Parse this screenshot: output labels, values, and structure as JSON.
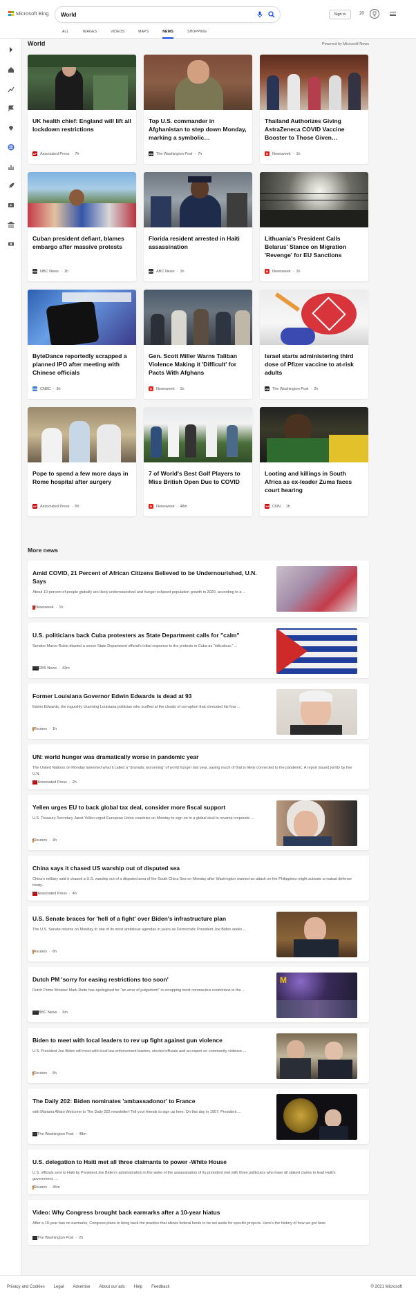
{
  "brand": {
    "name": "Microsoft Bing"
  },
  "search": {
    "value": "World",
    "placeholder": ""
  },
  "header": {
    "signin_label": "Sign in",
    "reward_count": "20"
  },
  "tabs": [
    {
      "label": "ALL"
    },
    {
      "label": "IMAGES"
    },
    {
      "label": "VIDEOS"
    },
    {
      "label": "MAPS"
    },
    {
      "label": "NEWS"
    },
    {
      "label": "SHOPPING"
    }
  ],
  "active_tab": "NEWS",
  "section": {
    "title": "World",
    "powered_by": "Powered by Microsoft News"
  },
  "cards": [
    {
      "title": "UK health chief: England will lift all lockdown restrictions",
      "source": "Associated Press",
      "age": "7h",
      "src_logo": "AP",
      "src_color": "#cc0000"
    },
    {
      "title": "Top U.S. commander in Afghanistan to step down Monday, marking a symbolic…",
      "source": "The Washington Post",
      "age": "7h",
      "src_logo": "wp",
      "src_color": "#222222"
    },
    {
      "title": "Thailand Authorizes Giving AstraZeneca COVID Vaccine Booster to Those Given…",
      "source": "Newsweek",
      "age": "1h",
      "src_logo": "N",
      "src_color": "#e2231a"
    },
    {
      "title": "Cuban president defiant, blames embargo after massive protests",
      "source": "NBC News",
      "age": "1h",
      "src_logo": "nbc",
      "src_color": "#333333"
    },
    {
      "title": "Florida resident arrested in Haiti assassination",
      "source": "ABC News",
      "age": "1h",
      "src_logo": "abc",
      "src_color": "#333333"
    },
    {
      "title": "Lithuania's President Calls Belarus' Stance on Migration 'Revenge' for EU Sanctions",
      "source": "Newsweek",
      "age": "1h",
      "src_logo": "N",
      "src_color": "#e2231a"
    },
    {
      "title": "ByteDance reportedly scrapped a planned IPO after meeting with Chinese officials",
      "source": "CNBC",
      "age": "3h",
      "src_logo": "cnbc",
      "src_color": "#3a7bd5"
    },
    {
      "title": "Gen. Scott Miller Warns Taliban Violence Making it 'Difficult' for Pacts With Afghans",
      "source": "Newsweek",
      "age": "1h",
      "src_logo": "N",
      "src_color": "#e2231a"
    },
    {
      "title": "Israel starts administering third dose of Pfizer vaccine to at-risk adults",
      "source": "The Washington Post",
      "age": "2h",
      "src_logo": "wp",
      "src_color": "#222222"
    },
    {
      "title": "Pope to spend a few more days in Rome hospital after surgery",
      "source": "Associated Press",
      "age": "5h",
      "src_logo": "AP",
      "src_color": "#cc0000"
    },
    {
      "title": "7 of World's Best Golf Players to Miss British Open Due to COVID",
      "source": "Newsweek",
      "age": "48m",
      "src_logo": "N",
      "src_color": "#e2231a"
    },
    {
      "title": "Looting and killings in South Africa as ex-leader Zuma faces court hearing",
      "source": "CNN",
      "age": "1h",
      "src_logo": "CNN",
      "src_color": "#cc0000"
    }
  ],
  "card_images": [
    "gov-speech-image",
    "military-commander-image",
    "vaccine-queue-image",
    "crowd-protest-image",
    "police-chief-image",
    "border-fence-image",
    "tiktok-logo-image",
    "taliban-crowd-image",
    "vaccine-injection-image",
    "pope-hospital-image",
    "golfers-image",
    "zuma-supporters-image"
  ],
  "more": {
    "title": "More news"
  },
  "rows": [
    {
      "title": "Amid COVID, 21 Percent of African Citizens Believed to be Undernourished, U.N. Says",
      "desc": "About 10 percent of people globally are likely undernourished and hunger eclipsed population growth in 2020, according to a ...",
      "source": "Newsweek",
      "age": "1h",
      "src_logo": "N",
      "src_color": "#e2231a",
      "has_image": true
    },
    {
      "title": "U.S. politicians back Cuba protesters as State Department calls for \"calm\"",
      "desc": "Senator Marco Rubio blasted a senior State Department official's initial response to the protests in Cuba as \"ridiculous.\" ...",
      "source": "CBS News",
      "age": "43m",
      "src_logo": "cbs",
      "src_color": "#222222",
      "has_image": true
    },
    {
      "title": "Former Louisiana Governor Edwin Edwards is dead at 93",
      "desc": "Edwin Edwards, the roguishly charming Louisiana politician who scoffed at the clouds of corruption that shrouded his four ...",
      "source": "Reuters",
      "age": "1h",
      "src_logo": "r",
      "src_color": "#f08a24",
      "has_image": true
    },
    {
      "title": "UN: world hunger was dramatically worse in pandemic year",
      "desc": "The United Nations on Monday lamented what it called a \"dramatic worsening\" of world hunger last year, saying much of that is likely connected to the pandemic. A report issued jointly by five U.N.",
      "source": "Associated Press",
      "age": "2h",
      "src_logo": "AP",
      "src_color": "#cc0000",
      "has_image": false
    },
    {
      "title": "Yellen urges EU to back global tax deal, consider more fiscal support",
      "desc": "U.S. Treasury Secretary Janet Yellen urged European Union countries on Monday to sign on to a global deal to revamp corporate ...",
      "source": "Reuters",
      "age": "4h",
      "src_logo": "r",
      "src_color": "#f08a24",
      "has_image": true
    },
    {
      "title": "China says it chased US warship out of disputed sea",
      "desc": "China's military said it chased a U.S. warship out of a disputed area of the South China Sea on Monday after Washington warned an attack on the Philippines might activate a mutual defense treaty.",
      "source": "Associated Press",
      "age": "4h",
      "src_logo": "AP",
      "src_color": "#cc0000",
      "has_image": false
    },
    {
      "title": "U.S. Senate braces for 'hell of a fight' over Biden's infrastructure plan",
      "desc": "The U.S. Senate returns on Monday to one of its most ambitious agendas in years as Democratic President Joe Biden seeks ...",
      "source": "Reuters",
      "age": "6h",
      "src_logo": "r",
      "src_color": "#f08a24",
      "has_image": true
    },
    {
      "title": "Dutch PM 'sorry for easing restrictions too soon'",
      "desc": "Dutch Prime Minister Mark Rutte has apologised for \"an error of judgement\" in scrapping most coronavirus restrictions in the ...",
      "source": "BBC News",
      "age": "6m",
      "src_logo": "bbc",
      "src_color": "#222222",
      "has_image": true
    },
    {
      "title": "Biden to meet with local leaders to rev up fight against gun violence",
      "desc": "U.S. President Joe Biden will meet with local law enforcement leaders, elected officials and an expert on community violence ...",
      "source": "Reuters",
      "age": "6h",
      "src_logo": "r",
      "src_color": "#f08a24",
      "has_image": true
    },
    {
      "title": "The Daily 202: Biden nominates 'ambassadonor' to France",
      "desc": "with Mariana Alfaro Welcome to The Daily 202 newsletter! Tell your friends to sign up here. On this day in 1957, President ...",
      "source": "The Washington Post",
      "age": "48m",
      "src_logo": "wp",
      "src_color": "#222222",
      "has_image": true
    },
    {
      "title": "U.S. delegation to Haiti met all three claimants to power -White House",
      "desc": "U.S. officials sent to Haiti by President Joe Biden's administration in the wake of the assassination of its president met with three politicians who have all staked claims to lead Haiti's government, ...",
      "source": "Reuters",
      "age": "45m",
      "src_logo": "r",
      "src_color": "#f08a24",
      "has_image": false
    },
    {
      "title": "Video: Why Congress brought back earmarks after a 10-year hiatus",
      "desc": "After a 10-year ban on earmarks, Congress plans to bring back the practice that allows federal funds to be set aside for specific projects. Here's the history of how we got here.",
      "source": "The Washington Post",
      "age": "2h",
      "src_logo": "wp",
      "src_color": "#222222",
      "has_image": false
    }
  ],
  "footer": {
    "links": [
      "Privacy and Cookies",
      "Legal",
      "Advertise",
      "About our ads",
      "Help",
      "Feedback"
    ],
    "copyright": "© 2021 Microsoft"
  }
}
